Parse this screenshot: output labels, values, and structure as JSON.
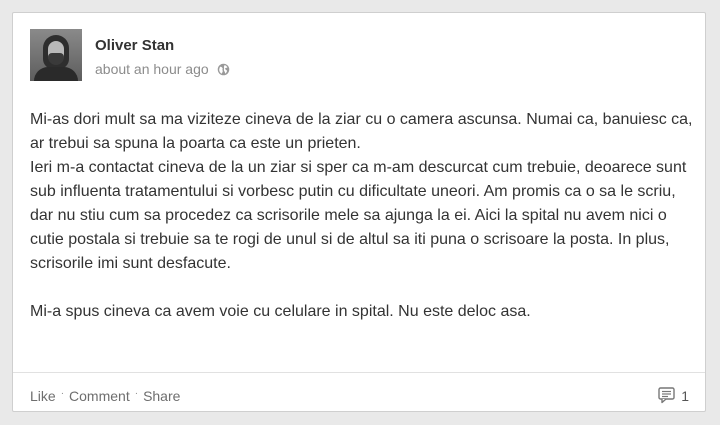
{
  "post": {
    "author": "Oliver Stan",
    "timestamp": "about an hour ago",
    "privacy_icon": "globe-icon",
    "paragraphs": [
      "Mi-as dori mult sa ma viziteze cineva de la ziar cu o camera ascunsa. Numai ca, banuiesc ca, ar trebui sa spuna la poarta ca este un prieten.\nIeri m-a contactat cineva de la un ziar si sper ca m-am descurcat cum trebuie, deoarece sunt sub influenta tratamentului si vorbesc putin cu dificultate uneori. Am promis ca o sa le scriu, dar nu stiu cum sa procedez ca scrisorile mele sa ajunga la ei. Aici la spital nu avem nici o cutie postala si trebuie sa te rogi de unul si de altul sa iti puna o scrisoare la posta. In plus, scrisorile imi sunt desfacute.",
      "Mi-a spus cineva ca avem voie cu celulare in spital. Nu este deloc asa."
    ]
  },
  "actions": {
    "like_label": "Like",
    "comment_label": "Comment",
    "share_label": "Share",
    "separator": "·"
  },
  "comments": {
    "icon": "comment-icon",
    "count": "1"
  },
  "colors": {
    "text": "#333333",
    "muted": "#8c8c8c",
    "background": "#e9e9e9",
    "card": "#ffffff"
  }
}
